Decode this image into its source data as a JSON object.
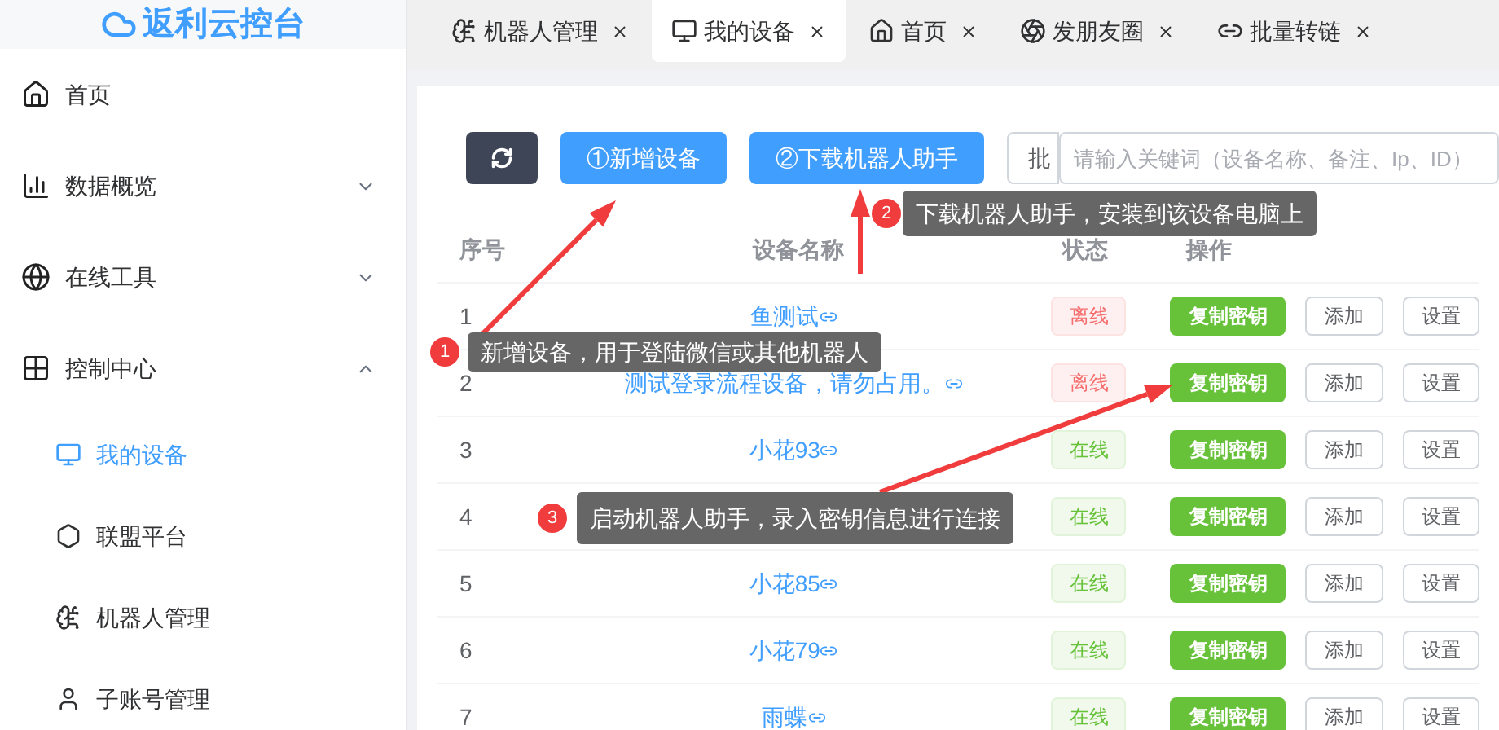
{
  "logo": {
    "title": "返利云控台"
  },
  "tabs": [
    {
      "label": "机器人管理",
      "selected": false
    },
    {
      "label": "我的设备",
      "selected": true
    },
    {
      "label": "首页",
      "selected": false
    },
    {
      "label": "发朋友圈",
      "selected": false
    },
    {
      "label": "批量转链",
      "selected": false
    }
  ],
  "sidebar": {
    "items": [
      {
        "label": "首页",
        "kind": "link"
      },
      {
        "label": "数据概览",
        "kind": "group",
        "expanded": false
      },
      {
        "label": "在线工具",
        "kind": "group",
        "expanded": false
      },
      {
        "label": "控制中心",
        "kind": "group",
        "expanded": true,
        "children": [
          {
            "label": "我的设备",
            "selected": true
          },
          {
            "label": "联盟平台",
            "selected": false
          },
          {
            "label": "机器人管理",
            "selected": false
          },
          {
            "label": "子账号管理",
            "selected": false
          }
        ]
      }
    ]
  },
  "toolbar": {
    "add_button": "①新增设备",
    "download_button": "②下载机器人助手",
    "search_prefix": "批",
    "search": {
      "placeholder": "请输入关键词（设备名称、备注、Ip、ID）"
    }
  },
  "table": {
    "columns": [
      "序号",
      "设备名称",
      "状态",
      "操作"
    ],
    "rows": [
      {
        "index": "1",
        "name": "鱼测试",
        "status": "离线",
        "online": false,
        "actions": [
          "复制密钥",
          "添加",
          "设置"
        ]
      },
      {
        "index": "2",
        "name": "测试登录流程设备，请勿占用。",
        "status": "离线",
        "online": false,
        "actions": [
          "复制密钥",
          "添加",
          "设置"
        ]
      },
      {
        "index": "3",
        "name": "小花93",
        "status": "在线",
        "online": true,
        "actions": [
          "复制密钥",
          "添加",
          "设置"
        ]
      },
      {
        "index": "4",
        "status": "在线",
        "online": true,
        "actions": [
          "复制密钥",
          "添加",
          "设置"
        ]
      },
      {
        "index": "5",
        "name": "小花85",
        "status": "在线",
        "online": true,
        "actions": [
          "复制密钥",
          "添加",
          "设置"
        ]
      },
      {
        "index": "6",
        "name": "小花79",
        "status": "在线",
        "online": true,
        "actions": [
          "复制密钥",
          "添加",
          "设置"
        ]
      },
      {
        "index": "7",
        "name": "雨蝶",
        "status": "在线",
        "online": true,
        "actions": [
          "复制密钥",
          "添加",
          "设置"
        ]
      }
    ]
  },
  "annotations": [
    {
      "number": "1",
      "text": "新增设备，用于登陆微信或其他机器人"
    },
    {
      "number": "2",
      "text": "下载机器人助手，安装到该设备电脑上"
    },
    {
      "number": "3",
      "text": "启动机器人助手，录入密钥信息进行连接"
    }
  ]
}
